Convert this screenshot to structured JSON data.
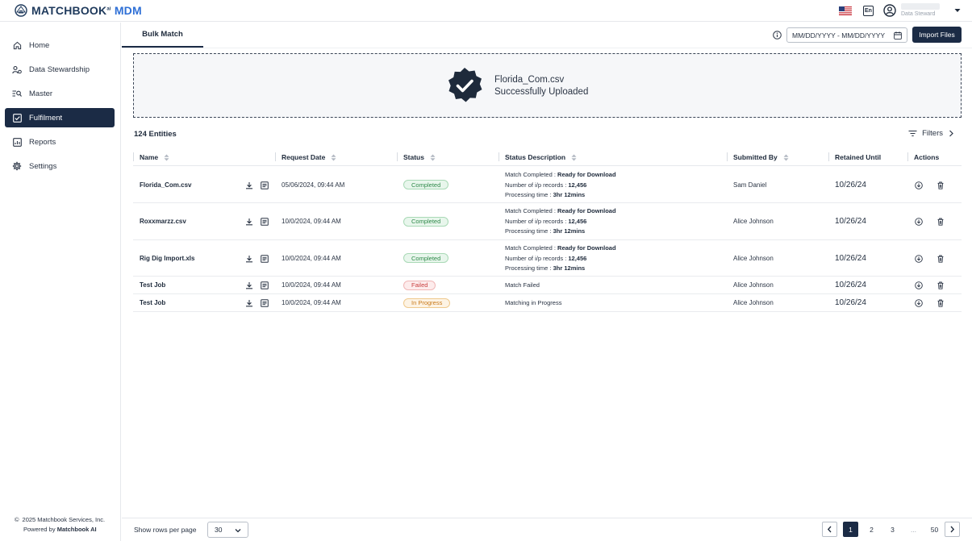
{
  "header": {
    "brand_main": "MATCHBOOK",
    "brand_sup": "ai",
    "brand_suffix": "MDM",
    "language": "En",
    "user_role": "Data Steward"
  },
  "sidebar": {
    "items": [
      {
        "label": "Home",
        "icon": "home-icon"
      },
      {
        "label": "Data Stewardship",
        "icon": "data-stewardship-icon"
      },
      {
        "label": "Master",
        "icon": "master-list-icon"
      },
      {
        "label": "Fulfilment",
        "icon": "checkbox-icon",
        "active": true
      },
      {
        "label": "Reports",
        "icon": "report-icon"
      },
      {
        "label": "Settings",
        "icon": "gear-icon"
      }
    ],
    "footer_copyright": "2025 Matchbook Services, Inc.",
    "footer_powered_prefix": "Powered by",
    "footer_powered_brand": "Matchbook AI"
  },
  "main": {
    "tab_label": "Bulk Match",
    "date_placeholder": "MM/DD/YYYY - MM/DD/YYYY",
    "import_label": "Import Files",
    "upload_filename": "Florida_Com.csv",
    "upload_status": "Successfully Uploaded",
    "entities_label": "124 Entities",
    "filters_label": "Filters"
  },
  "table": {
    "headers": {
      "name": "Name",
      "request_date": "Request Date",
      "status": "Status",
      "status_description": "Status Description",
      "submitted_by": "Submitted By",
      "retained_until": "Retained Until",
      "actions": "Actions"
    },
    "rows": [
      {
        "name": "Florida_Com.csv",
        "date": "05/06/2024, 09:44 AM",
        "status": "Completed",
        "desc_l1_prefix": "Match Completed :",
        "desc_l1_bold": "Ready for Download",
        "desc_l2_prefix": "Number of i/p records :",
        "desc_l2_bold": "12,456",
        "desc_l3_prefix": "Processing time :",
        "desc_l3_bold": "3hr 12mins",
        "submitted_by": "Sam Daniel",
        "retained": "10/26/24"
      },
      {
        "name": "Roxxmarzz.csv",
        "date": "10/0/2024, 09:44 AM",
        "status": "Completed",
        "desc_l1_prefix": "Match Completed :",
        "desc_l1_bold": "Ready for Download",
        "desc_l2_prefix": "Number of i/p records :",
        "desc_l2_bold": "12,456",
        "desc_l3_prefix": "Processing time :",
        "desc_l3_bold": "3hr 12mins",
        "submitted_by": "Alice Johnson",
        "retained": "10/26/24"
      },
      {
        "name": "Rig Dig Import.xls",
        "date": "10/0/2024, 09:44 AM",
        "status": "Completed",
        "desc_l1_prefix": "Match Completed :",
        "desc_l1_bold": "Ready for Download",
        "desc_l2_prefix": "Number of i/p records :",
        "desc_l2_bold": "12,456",
        "desc_l3_prefix": "Processing time :",
        "desc_l3_bold": "3hr 12mins",
        "submitted_by": "Alice Johnson",
        "retained": "10/26/24"
      },
      {
        "name": "Test Job",
        "date": "10/0/2024, 09:44 AM",
        "status": "Failed",
        "desc_single": "Match Failed",
        "submitted_by": "Alice Johnson",
        "retained": "10/26/24"
      },
      {
        "name": "Test Job",
        "date": "10/0/2024, 09:44 AM",
        "status": "In Progress",
        "desc_single": "Matching in Progress",
        "submitted_by": "Alice Johnson",
        "retained": "10/26/24"
      }
    ]
  },
  "footer": {
    "rows_label": "Show rows per page",
    "rows_value": "30",
    "pages": [
      "1",
      "2",
      "3",
      "...",
      "50"
    ],
    "current_page": "1"
  },
  "colors": {
    "primary": "#1b2b45",
    "accent_blue": "#2e6fd6",
    "completed": "#2f8a4a",
    "failed": "#c94040",
    "in_progress": "#c97a1b"
  }
}
